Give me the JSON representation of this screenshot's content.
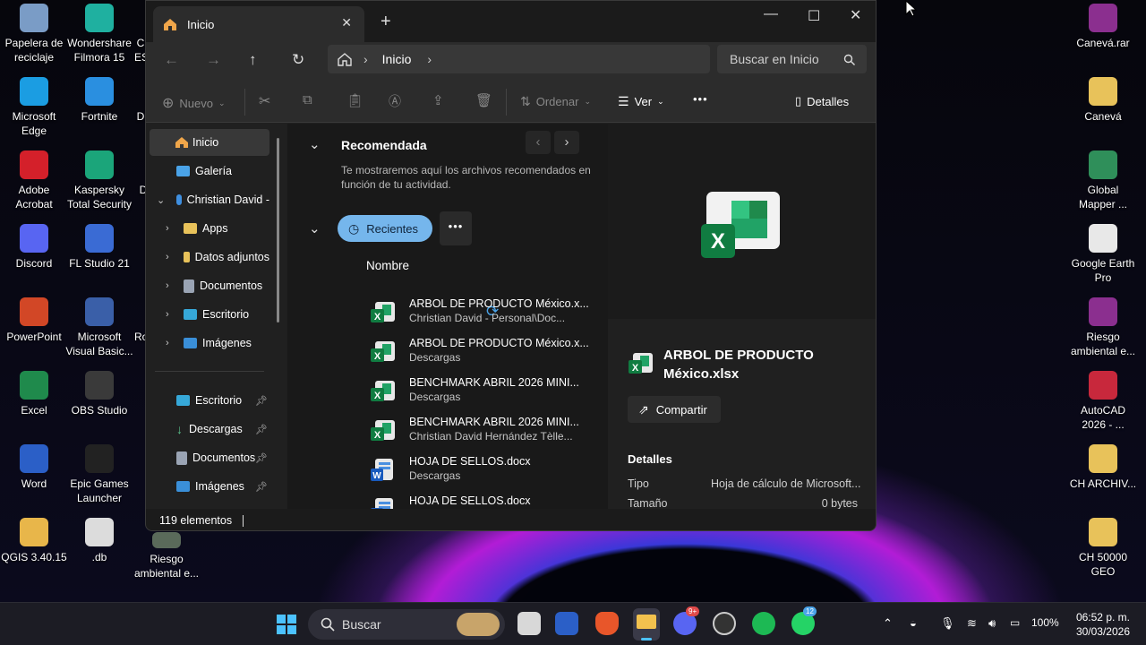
{
  "desktop": {
    "left_col1": [
      {
        "label": "Papelera de reciclaje",
        "icon": "recycle-bin-icon",
        "color": "#7a9cc6"
      },
      {
        "label": "Microsoft Edge",
        "icon": "edge-icon",
        "color": "#1b9de2"
      },
      {
        "label": "Adobe Acrobat",
        "icon": "acrobat-icon",
        "color": "#d4202a"
      },
      {
        "label": "Discord",
        "icon": "discord-icon",
        "color": "#5865f2"
      },
      {
        "label": "PowerPoint",
        "icon": "powerpoint-icon",
        "color": "#d24726"
      },
      {
        "label": "Excel",
        "icon": "excel-icon",
        "color": "#1f8a4c"
      },
      {
        "label": "Word",
        "icon": "word-icon",
        "color": "#2b5fc7"
      },
      {
        "label": "QGIS 3.40.15",
        "icon": "folder-icon",
        "color": "#e8b64a"
      }
    ],
    "left_col2": [
      {
        "label": "Wondershare Filmora 15",
        "icon": "filmora-icon",
        "color": "#1fb0a0"
      },
      {
        "label": "Fortnite",
        "icon": "fortnite-icon",
        "color": "#2a8fe0"
      },
      {
        "label": "Kaspersky Total Security",
        "icon": "kaspersky-icon",
        "color": "#1ba57a"
      },
      {
        "label": "FL Studio 21",
        "icon": "fl-studio-icon",
        "color": "#3a6bd4"
      },
      {
        "label": "Microsoft Visual Basic...",
        "icon": "visual-basic-icon",
        "color": "#3a5fa8"
      },
      {
        "label": "OBS Studio",
        "icon": "obs-icon",
        "color": "#3a3a3a"
      },
      {
        "label": "Epic Games Launcher",
        "icon": "epic-games-icon",
        "color": "#222222"
      },
      {
        "label": ".db",
        "icon": "db-file-icon",
        "color": "#dcdcdc"
      }
    ],
    "left_col3_partial": [
      "C",
      "ES",
      "D",
      "D",
      "Ro"
    ],
    "riesgo_bottom": "Riesgo ambiental e...",
    "right_col": [
      {
        "label": "Canevá.rar",
        "icon": "winrar-icon",
        "color": "#8b2f8f"
      },
      {
        "label": "Canevá",
        "icon": "folder-icon",
        "color": "#e8c25a"
      },
      {
        "label": "Global Mapper ...",
        "icon": "global-mapper-icon",
        "color": "#2f8f5a"
      },
      {
        "label": "Google Earth Pro",
        "icon": "file-icon",
        "color": "#e8e8e8"
      },
      {
        "label": "Riesgo ambiental e...",
        "icon": "winrar-icon",
        "color": "#8b2f8f"
      },
      {
        "label": "AutoCAD 2026 - ...",
        "icon": "autocad-icon",
        "color": "#c8283c"
      },
      {
        "label": "CH ARCHIV...",
        "icon": "folder-icon",
        "color": "#e8c25a"
      },
      {
        "label": "CH 50000 GEO",
        "icon": "folder-icon",
        "color": "#e8c25a"
      }
    ]
  },
  "window": {
    "tab_title": "Inicio",
    "address": {
      "crumb": "Inicio",
      "search_placeholder": "Buscar en Inicio"
    },
    "commands": {
      "new": "Nuevo",
      "sort": "Ordenar",
      "view": "Ver",
      "details": "Detalles",
      "more": "•••"
    },
    "nav": {
      "items": [
        {
          "label": "Inicio",
          "icon": "home-icon"
        },
        {
          "label": "Galería",
          "icon": "gallery-icon"
        },
        {
          "label": "Christian David -",
          "icon": "cloud-icon"
        },
        {
          "label": "Apps",
          "icon": "folder-icon"
        },
        {
          "label": "Datos adjuntos",
          "icon": "folder-icon"
        },
        {
          "label": "Documentos",
          "icon": "documents-icon"
        },
        {
          "label": "Escritorio",
          "icon": "desktop-icon"
        },
        {
          "label": "Imágenes",
          "icon": "pictures-icon"
        }
      ],
      "pinned": [
        {
          "label": "Escritorio"
        },
        {
          "label": "Descargas"
        },
        {
          "label": "Documentos"
        },
        {
          "label": "Imágenes"
        }
      ]
    },
    "content": {
      "recommended_title": "Recomendada",
      "recommended_desc_1": "Te mostraremos aquí los archivos recomendados en",
      "recommended_desc_2": "función de tu actividad.",
      "recent_button": "Recientes",
      "column_header": "Nombre",
      "files": [
        {
          "name": "ARBOL DE PRODUCTO México.x...",
          "location": "Christian David - Personal\\Doc...",
          "type": "excel"
        },
        {
          "name": "ARBOL DE PRODUCTO México.x...",
          "location": "Descargas",
          "type": "excel"
        },
        {
          "name": "BENCHMARK ABRIL 2026 MINI...",
          "location": "Descargas",
          "type": "excel"
        },
        {
          "name": "BENCHMARK ABRIL 2026 MINI...",
          "location": "Christian David Hernández Tèlle...",
          "type": "excel"
        },
        {
          "name": "HOJA DE SELLOS.docx",
          "location": "Descargas",
          "type": "word"
        },
        {
          "name": "HOJA DE SELLOS.docx",
          "location": "",
          "type": "word"
        }
      ]
    },
    "preview": {
      "file_title_1": "ARBOL DE PRODUCTO",
      "file_title_2": "México.xlsx",
      "share": "Compartir",
      "details_title": "Detalles",
      "type_label": "Tipo",
      "type_value": "Hoja de cálculo de Microsoft...",
      "size_label": "Tamaño",
      "size_value": "0 bytes"
    },
    "status": "119 elementos"
  },
  "taskbar": {
    "search": "Buscar",
    "battery": "100%",
    "time": "06:52 p. m.",
    "date": "30/03/2026",
    "discord_badge": "9+",
    "whatsapp_badge": "12"
  }
}
